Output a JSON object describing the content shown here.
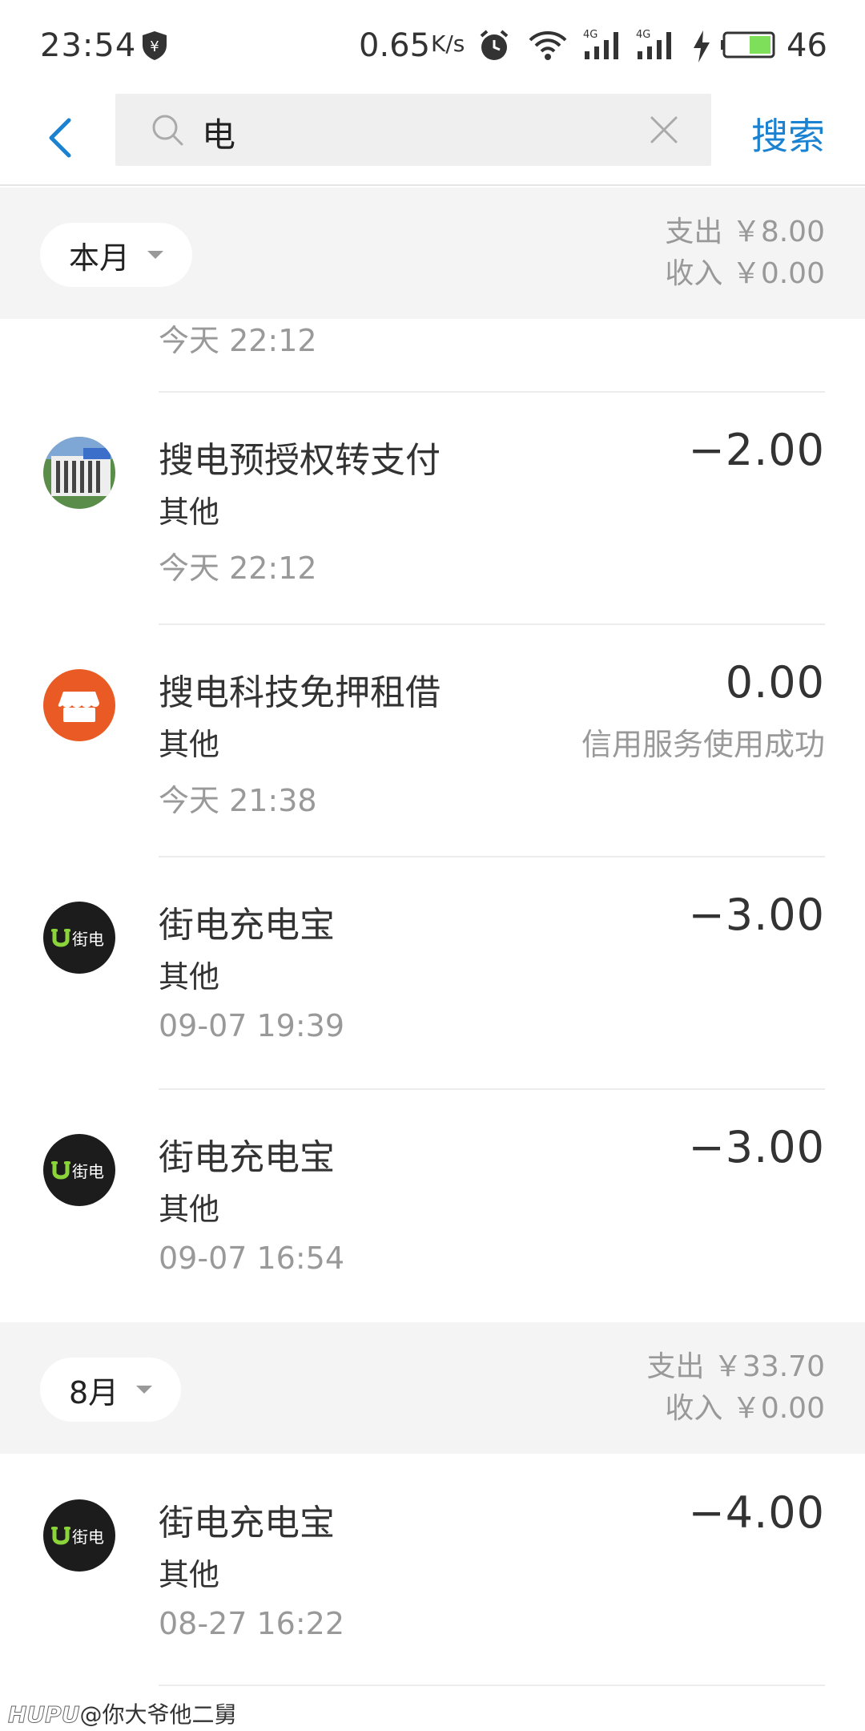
{
  "status_bar": {
    "time": "23:54",
    "net_speed": "0.65",
    "net_speed_unit": "K/s",
    "battery": "46",
    "icons": [
      "shield-yen-icon",
      "alarm-icon",
      "wifi-icon",
      "signal-4g-icon",
      "signal-4g-icon",
      "charging-icon",
      "battery-icon"
    ]
  },
  "search": {
    "query": "电",
    "button_label": "搜索"
  },
  "months": [
    {
      "label": "本月",
      "expense": "支出 ￥8.00",
      "income": "收入 ￥0.00"
    },
    {
      "label": "8月",
      "expense": "支出 ￥33.70",
      "income": "收入 ￥0.00"
    }
  ],
  "partial_first_time": "今天  22:12",
  "transactions": [
    {
      "name": "搜电预授权转支付",
      "category": "其他",
      "time": "今天  22:12",
      "amount": "−2.00",
      "note": "",
      "avatar": "photo-avatar"
    },
    {
      "name": "搜电科技免押租借",
      "category": "其他",
      "time": "今天  21:38",
      "amount": "0.00",
      "note": "信用服务使用成功",
      "avatar": "store-icon"
    },
    {
      "name": "街电充电宝",
      "category": "其他",
      "time": "09-07  19:39",
      "amount": "−3.00",
      "note": "",
      "avatar": "jiedian-logo"
    },
    {
      "name": "街电充电宝",
      "category": "其他",
      "time": "09-07  16:54",
      "amount": "−3.00",
      "note": "",
      "avatar": "jiedian-logo"
    },
    {
      "name": "街电充电宝",
      "category": "其他",
      "time": "08-27  16:22",
      "amount": "−4.00",
      "note": "",
      "avatar": "jiedian-logo"
    }
  ],
  "logo_text": "街电",
  "watermark": {
    "brand": "HUPU",
    "user": "@你大爷他二舅"
  },
  "colors": {
    "accent": "#1b82d2",
    "store_orange": "#ea5a24",
    "jiedian_green": "#8bd43a"
  }
}
